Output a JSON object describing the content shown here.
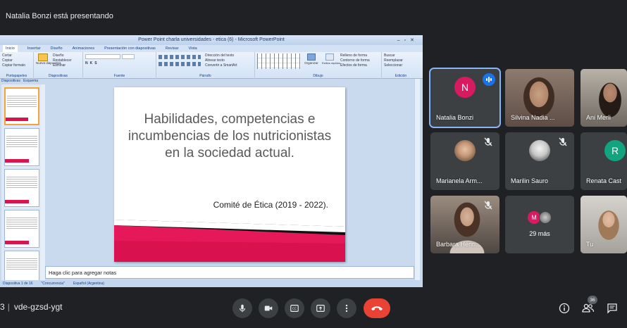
{
  "presenter_banner": "Natalia Bonzi está presentando",
  "ppt": {
    "window_title": "Power Point charla universidades - etica (6) - Microsoft PowerPoint",
    "tabs": [
      "Inicio",
      "Insertar",
      "Diseño",
      "Animaciones",
      "Presentación con diapositivas",
      "Revisar",
      "Vista"
    ],
    "ribbon_groups": [
      "Portapapeles",
      "Diapositivas",
      "Fuente",
      "Párrafo",
      "Dibujo",
      "Edición"
    ],
    "ribbon_controls": {
      "clipboard": [
        "Cortar",
        "Copiar",
        "Copiar formato"
      ],
      "slides": [
        "Nueva diapositiva",
        "Diseño",
        "Restablecer",
        "Eliminar"
      ],
      "paragraph": [
        "Dirección del texto",
        "Alinear texto",
        "Convertir a SmartArt"
      ],
      "drawing": [
        "Organizar",
        "Estilos rápidos",
        "Relleno de forma",
        "Contorno de forma",
        "Efectos de forma"
      ],
      "editing": [
        "Buscar",
        "Reemplazar",
        "Seleccionar"
      ]
    },
    "pane_tabs": [
      "Diapositivas",
      "Esquema"
    ],
    "slide": {
      "title": "Habilidades, competencias e incumbencias de los nutricionistas en la sociedad actual.",
      "subtitle": "Comité de Ética (2019 - 2022)."
    },
    "notes_placeholder": "Haga clic para agregar notas",
    "status": [
      "Diapositiva 1 de 16",
      "\"Concurrencia\"",
      "Español (Argentina)"
    ]
  },
  "participants": [
    {
      "name": "Natalia Bonzi",
      "initial": "N",
      "color": "#d81b60",
      "active": true,
      "muted": false
    },
    {
      "name": "Silvina Nadia ...",
      "muted": false
    },
    {
      "name": "Ani Merli",
      "muted": false
    },
    {
      "name": "Marianela Arm...",
      "muted": true
    },
    {
      "name": "Marilin Sauro",
      "muted": true
    },
    {
      "name": "Renata Cast",
      "initial": "R",
      "color": "#12a37f",
      "muted": false
    },
    {
      "name": "Barbara Henri...",
      "muted": true
    },
    {
      "name": "29 más",
      "initial": "M",
      "color": "#d81b60"
    },
    {
      "name": "Tu",
      "muted": true
    }
  ],
  "meeting": {
    "code": "vde-gzsd-ygt",
    "time": "3"
  },
  "controls": [
    "mic",
    "camera",
    "captions",
    "present",
    "more",
    "end-call"
  ],
  "right_controls": {
    "people_count": "36"
  },
  "colors": {
    "accent": "#8ab4f8",
    "end_call": "#ea4335",
    "tile_bg": "#3c4043",
    "slide_pink": "#e5185a"
  }
}
